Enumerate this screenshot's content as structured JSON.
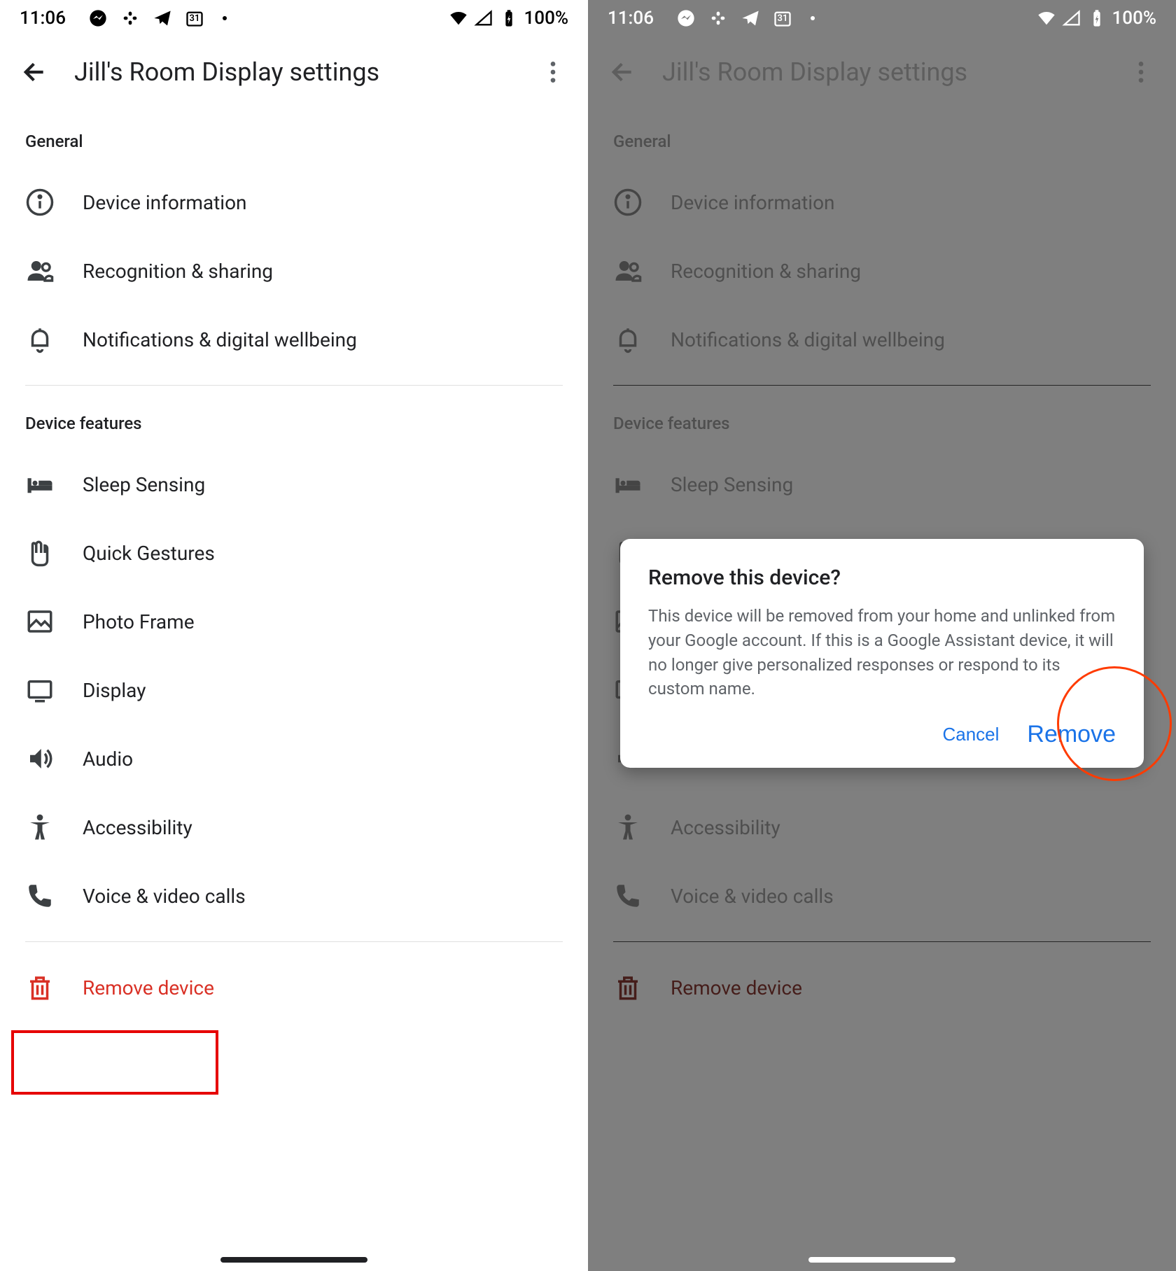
{
  "status": {
    "time": "11:06",
    "battery": "100%",
    "calendar_day": "31"
  },
  "appbar": {
    "title": "Jill's Room Display settings"
  },
  "sections": {
    "general": {
      "label": "General",
      "items": [
        {
          "icon": "info-icon",
          "label": "Device information"
        },
        {
          "icon": "people-icon",
          "label": "Recognition & sharing"
        },
        {
          "icon": "bell-icon",
          "label": "Notifications & digital wellbeing"
        }
      ]
    },
    "features": {
      "label": "Device features",
      "items": [
        {
          "icon": "bed-icon",
          "label": "Sleep Sensing"
        },
        {
          "icon": "hand-icon",
          "label": "Quick Gestures"
        },
        {
          "icon": "photo-icon",
          "label": "Photo Frame"
        },
        {
          "icon": "display-icon",
          "label": "Display"
        },
        {
          "icon": "audio-icon",
          "label": "Audio"
        },
        {
          "icon": "accessibility-icon",
          "label": "Accessibility"
        },
        {
          "icon": "phone-icon",
          "label": "Voice & video calls"
        }
      ]
    },
    "remove": {
      "label": "Remove device"
    }
  },
  "dialog": {
    "title": "Remove this device?",
    "body": "This device will be removed from your home and unlinked from your Google account. If this is a Google Assistant device, it will no longer give personalized responses or respond to its custom name.",
    "cancel": "Cancel",
    "confirm": "Remove"
  }
}
